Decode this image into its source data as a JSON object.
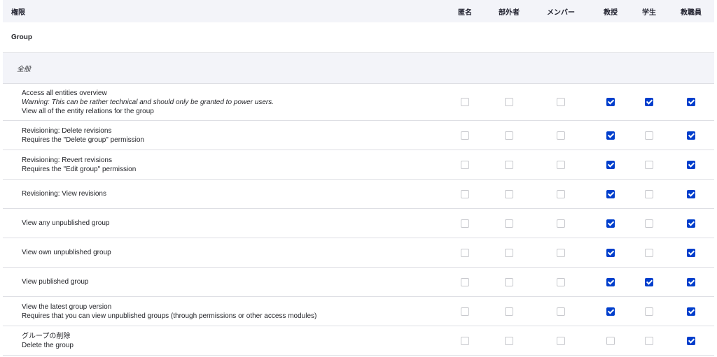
{
  "header": {
    "permission": "権限",
    "roles": [
      "匿名",
      "部外者",
      "メンバー",
      "教授",
      "学生",
      "教職員"
    ]
  },
  "group_label": "Group",
  "section_label": "全般",
  "rows": [
    {
      "title": "Access all entities overview",
      "warning": "Warning: This can be rather technical and should only be granted to power users.",
      "description": "View all of the entity relations for the group",
      "checks": [
        false,
        false,
        false,
        true,
        true,
        true
      ]
    },
    {
      "title": "Revisioning: Delete revisions",
      "warning": "",
      "description": "Requires the \"Delete group\" permission",
      "checks": [
        false,
        false,
        false,
        true,
        false,
        true
      ]
    },
    {
      "title": "Revisioning: Revert revisions",
      "warning": "",
      "description": "Requires the \"Edit group\" permission",
      "checks": [
        false,
        false,
        false,
        true,
        false,
        true
      ]
    },
    {
      "title": "Revisioning: View revisions",
      "warning": "",
      "description": "",
      "checks": [
        false,
        false,
        false,
        true,
        false,
        true
      ]
    },
    {
      "title": "View any unpublished group",
      "warning": "",
      "description": "",
      "checks": [
        false,
        false,
        false,
        true,
        false,
        true
      ]
    },
    {
      "title": "View own unpublished group",
      "warning": "",
      "description": "",
      "checks": [
        false,
        false,
        false,
        true,
        false,
        true
      ]
    },
    {
      "title": "View published group",
      "warning": "",
      "description": "",
      "checks": [
        false,
        false,
        false,
        true,
        true,
        true
      ]
    },
    {
      "title": "View the latest group version",
      "warning": "",
      "description": "Requires that you can view unpublished groups (through permissions or other access modules)",
      "checks": [
        false,
        false,
        false,
        true,
        false,
        true
      ]
    },
    {
      "title": "グループの削除",
      "warning": "",
      "description": "Delete the group",
      "checks": [
        false,
        false,
        false,
        false,
        false,
        true
      ]
    }
  ]
}
